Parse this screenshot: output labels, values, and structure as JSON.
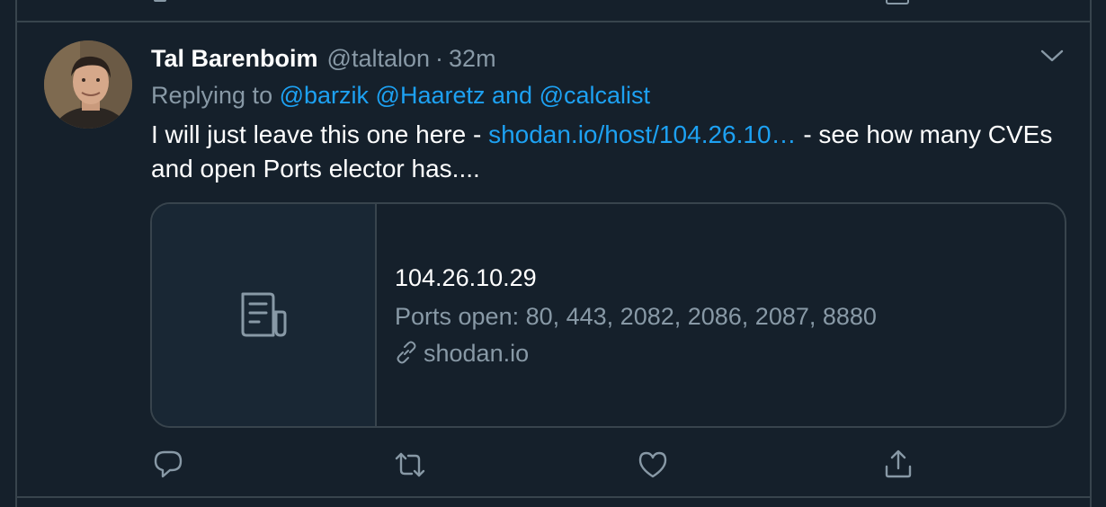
{
  "tweet": {
    "display_name": "Tal Barenboim",
    "handle": "@taltalon",
    "separator": "·",
    "time": "32m",
    "reply_prefix": "Replying to ",
    "reply_to_1": "@barzik",
    "reply_to_2": "@Haaretz",
    "reply_and": " and ",
    "reply_to_3": "@calcalist",
    "text_before_link": "I will just leave this one here - ",
    "link_text": "shodan.io/host/104.26.10…",
    "text_after_link": " - see how many CVEs and open Ports elector has...."
  },
  "card": {
    "title": "104.26.10.29",
    "description": "Ports open: 80, 443, 2082, 2086, 2087, 8880",
    "domain": "shodan.io",
    "thumbnail_icon": "document-icon",
    "domain_icon": "link-icon"
  },
  "actions": {
    "reply_icon": "reply-icon",
    "retweet_icon": "retweet-icon",
    "like_icon": "heart-icon",
    "share_icon": "share-icon"
  },
  "colors": {
    "background": "#15202b",
    "border": "#38444d",
    "secondary_text": "#8899a6",
    "link": "#1da1f2",
    "card_thumb_bg": "#192734"
  }
}
